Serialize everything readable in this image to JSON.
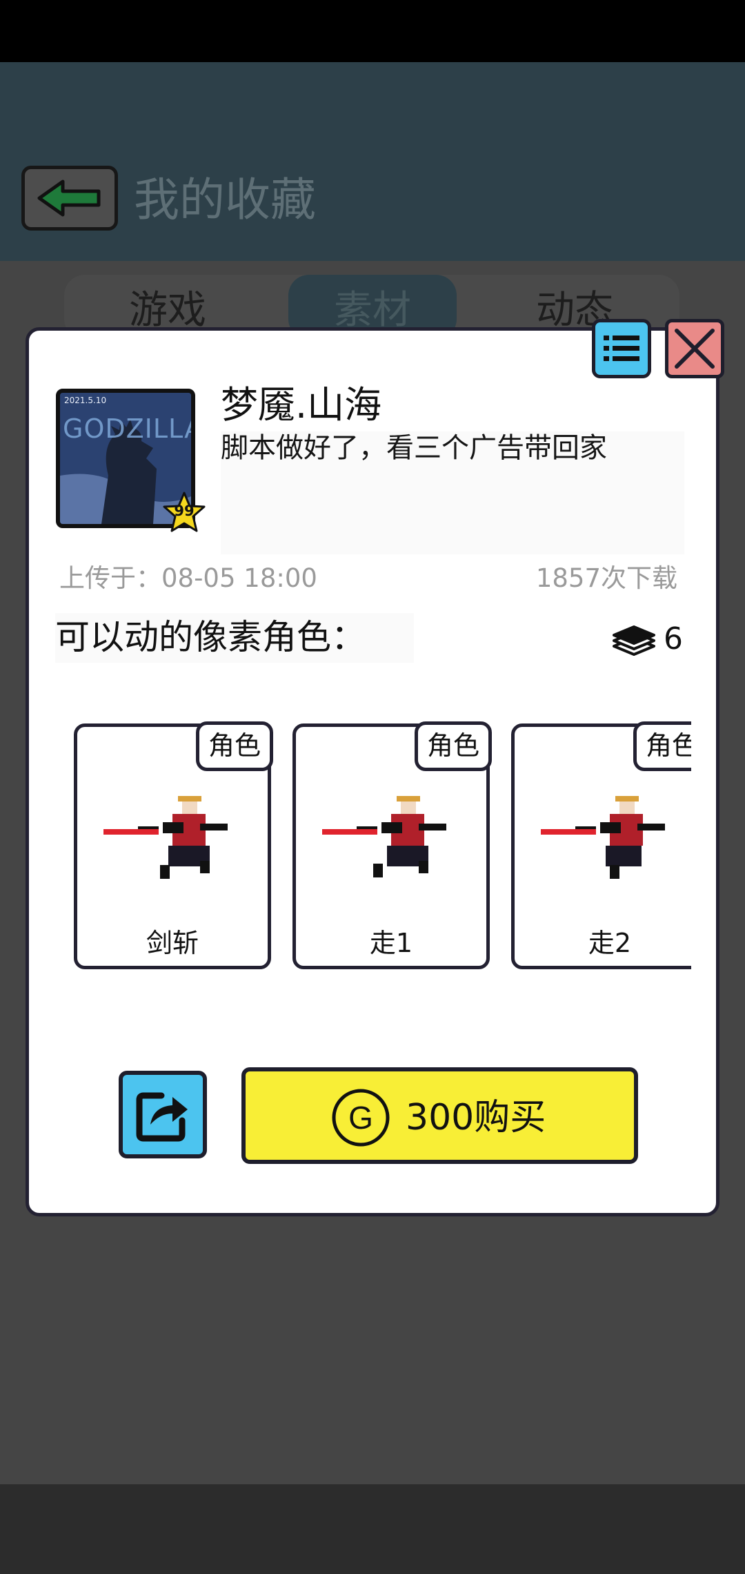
{
  "header": {
    "title": "我的收藏",
    "back_icon": "back-arrow-icon"
  },
  "tabs": [
    {
      "label": "游戏",
      "active": false
    },
    {
      "label": "素材",
      "active": true
    },
    {
      "label": "动态",
      "active": false
    }
  ],
  "dialog": {
    "list_icon": "list-icon",
    "close_icon": "close-icon",
    "item": {
      "thumbnail_text": "GODZILLA",
      "thumbnail_date": "2021.5.10",
      "level": "99",
      "title": "梦魇.山海",
      "description": "脚本做好了，看三个广告带回家",
      "upload_time": "上传于：08-05 18:00",
      "downloads": "1857次下载"
    },
    "section": {
      "title": "可以动的像素角色：",
      "layers_icon": "layers-icon",
      "layer_count": "6"
    },
    "cards": [
      {
        "tag": "角色",
        "label": "剑斩"
      },
      {
        "tag": "角色",
        "label": "走1"
      },
      {
        "tag": "角色",
        "label": "走2"
      }
    ],
    "actions": {
      "share_icon": "share-icon",
      "buy_label": "300购买",
      "coin_icon": "coin-icon",
      "coin_letter": "G"
    }
  },
  "colors": {
    "header_bg": "#2d4049",
    "overlay_bg": "#454545",
    "accent_blue": "#4cc4ef",
    "close_red": "#e98a88",
    "buy_yellow": "#f8ee36",
    "back_arrow_green": "#1e7a3a"
  }
}
